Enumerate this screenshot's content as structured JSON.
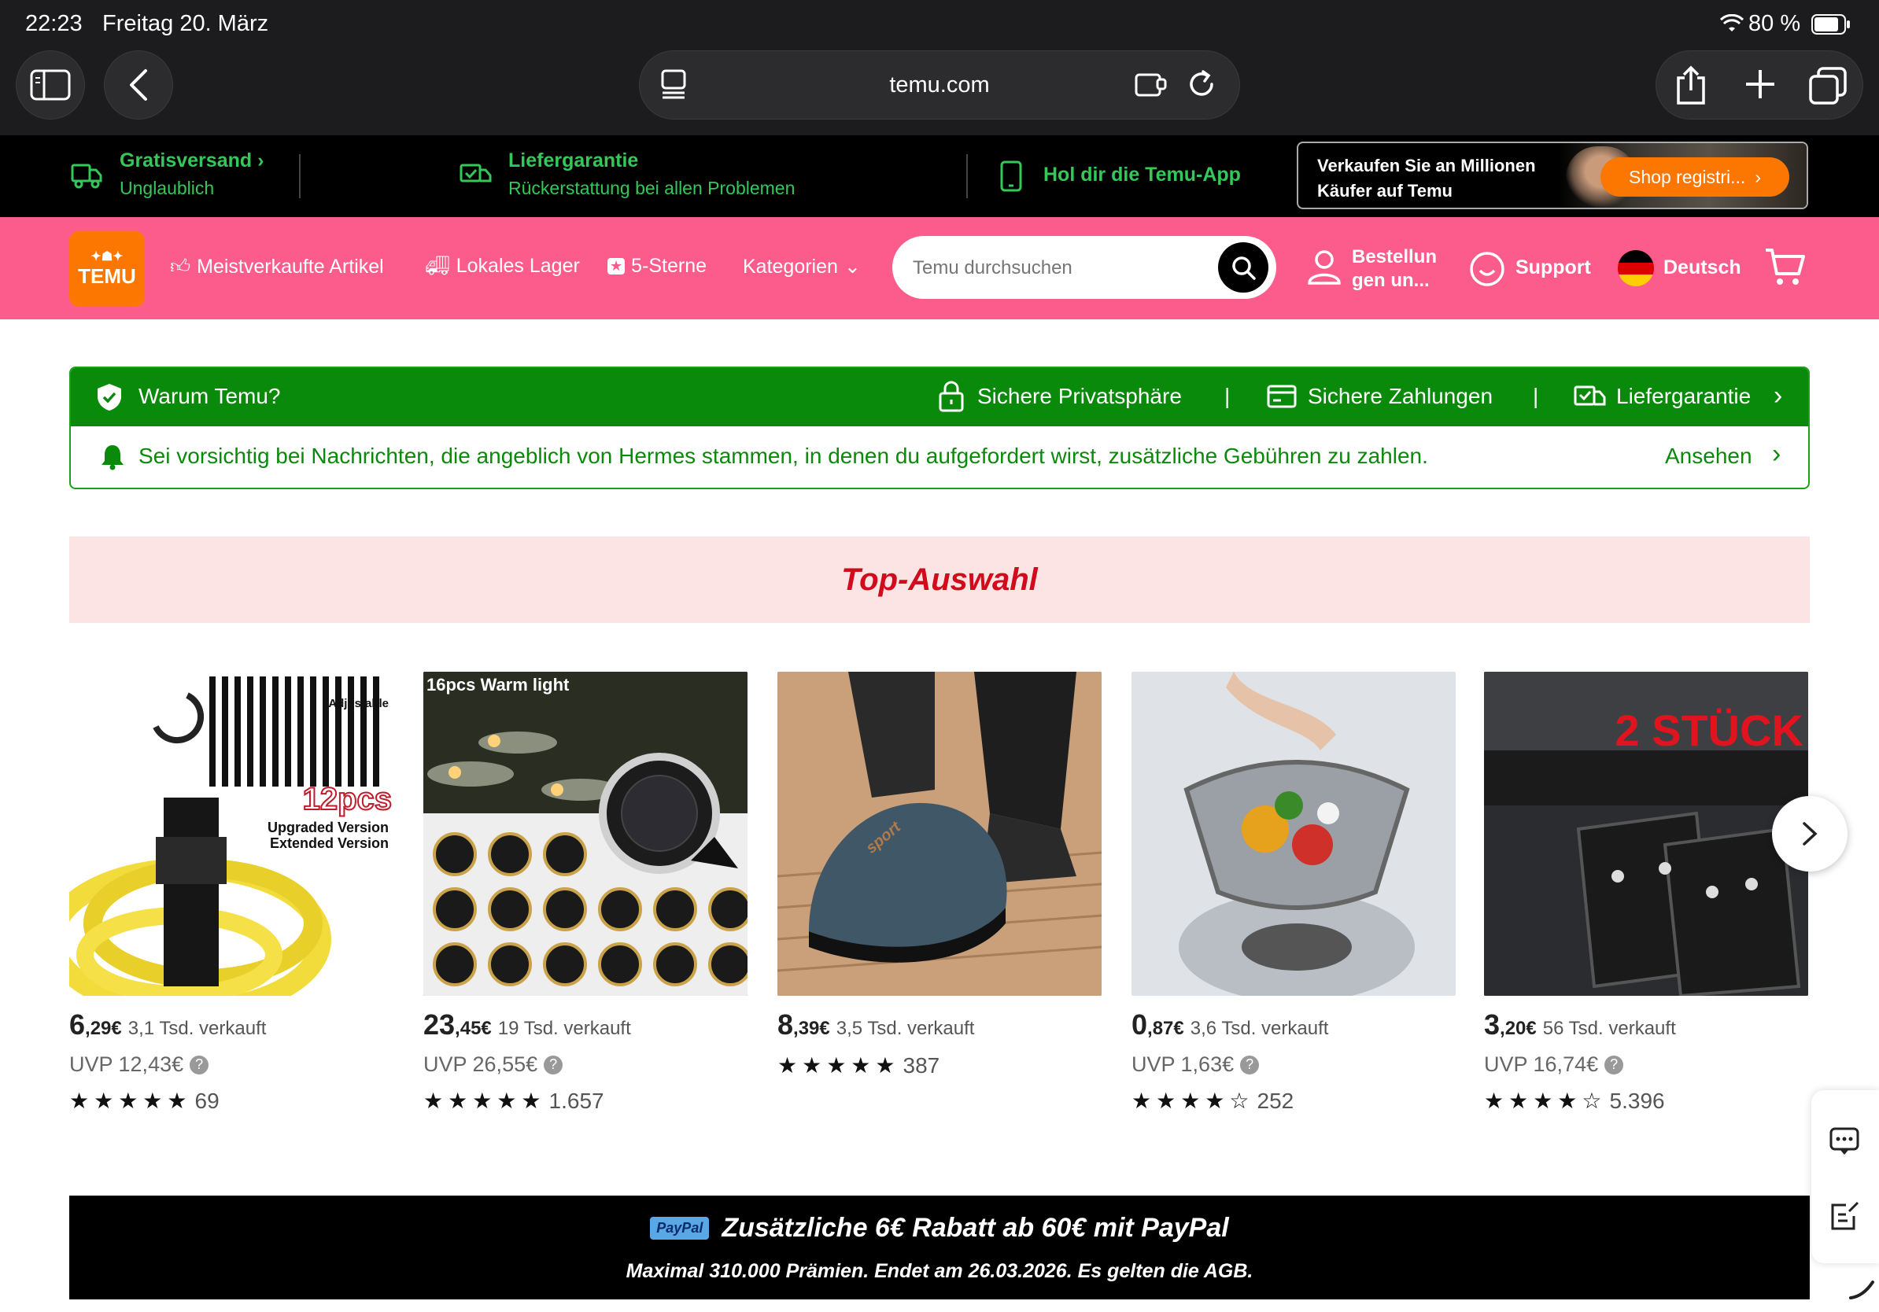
{
  "status": {
    "time": "22:23",
    "date": "Freitag 20. März",
    "battery": "80 %"
  },
  "browser": {
    "url": "temu.com"
  },
  "promo": {
    "shipping_title": "Gratisversand",
    "shipping_sub": "Unglaublich",
    "delivery_title": "Liefergarantie",
    "delivery_sub": "Rückerstattung bei allen Problemen",
    "app_label": "Hol dir die Temu-App",
    "sell_line1": "Verkaufen Sie an Millionen",
    "sell_line2": "Käufer auf Temu",
    "shop_button": "Shop registri..."
  },
  "nav": {
    "logo_text": "TEMU",
    "bestsellers": "Meistverkaufte Artikel",
    "local": "Lokales Lager",
    "five_star": "5-Sterne",
    "categories": "Kategorien",
    "search_placeholder": "Temu durchsuchen",
    "orders_line1": "Bestellun",
    "orders_line2": "gen un...",
    "support": "Support",
    "language": "Deutsch"
  },
  "warum": {
    "title": "Warum Temu?",
    "privacy": "Sichere Privatsphäre",
    "payments": "Sichere Zahlungen",
    "guarantee": "Liefergarantie",
    "notice": "Sei vorsichtig bei Nachrichten, die angeblich von Hermes stammen, in denen du aufgefordert wirst, zusätzliche Gebühren zu zahlen.",
    "view": "Ansehen"
  },
  "top": {
    "title": "Top-Auswahl"
  },
  "products": [
    {
      "price_int": "6",
      "price_dec": ",29€",
      "sold": "3,1 Tsd. verkauft",
      "uvp": "UVP 12,43€",
      "stars": "★★★★★",
      "reviews": "69",
      "img_label_1": "Adjustable",
      "img_label_2": "12pcs",
      "img_label_3": "Upgraded Version",
      "img_label_4": "Extended Version"
    },
    {
      "price_int": "23",
      "price_dec": ",45€",
      "sold": "19 Tsd. verkauft",
      "uvp": "UVP 26,55€",
      "stars": "★★★★★",
      "reviews": "1.657",
      "img_label_1": "16pcs Warm light"
    },
    {
      "price_int": "8",
      "price_dec": ",39€",
      "sold": "3,5 Tsd. verkauft",
      "uvp": "",
      "stars": "★★★★★",
      "reviews": "387",
      "img_label_1": "sport"
    },
    {
      "price_int": "0",
      "price_dec": ",87€",
      "sold": "3,6 Tsd. verkauft",
      "uvp": "UVP 1,63€",
      "stars": "★★★★☆",
      "reviews": "252"
    },
    {
      "price_int": "3",
      "price_dec": ",20€",
      "sold": "56 Tsd. verkauft",
      "uvp": "UVP 16,74€",
      "stars": "★★★★☆",
      "reviews": "5.396",
      "img_label_1": "2 STÜCK"
    }
  ],
  "paypal": {
    "badge": "PayPal",
    "title": "Zusätzliche 6€ Rabatt ab 60€ mit PayPal",
    "sub": "Maximal 310.000 Prämien. Endet am 26.03.2026. Es gelten die AGB."
  },
  "colors": {
    "nav_pink": "#fb5c8c",
    "green": "#0a8a0a",
    "temu_orange": "#fb7701",
    "red_title": "#d10b1c"
  }
}
